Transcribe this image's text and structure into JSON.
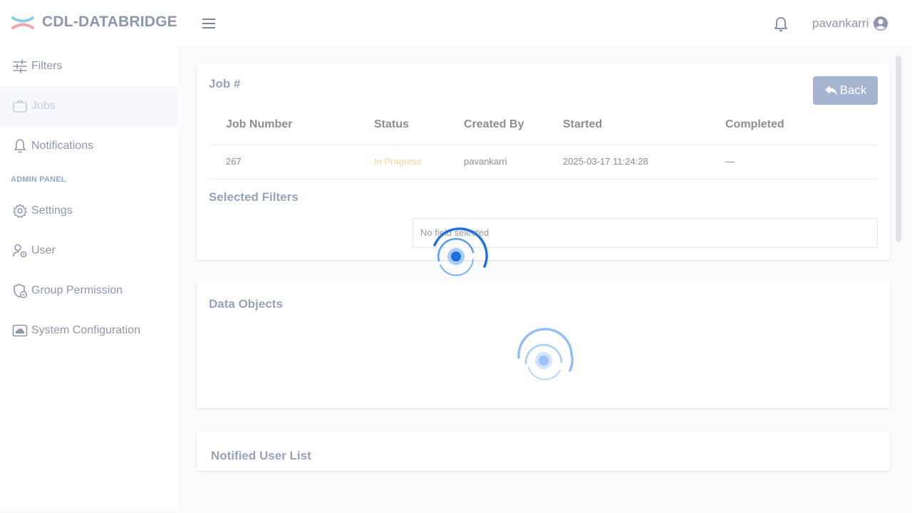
{
  "header": {
    "brand": "CDL-DATABRIDGE",
    "username": "pavankarri",
    "icons": [
      "logo-icon",
      "menu-icon",
      "bell-icon",
      "user-circle-icon"
    ]
  },
  "sidebar": {
    "items": [
      {
        "label": "Filters",
        "icon": "filters-icon"
      },
      {
        "label": "Jobs",
        "icon": "briefcase-icon"
      },
      {
        "label": "Notifications",
        "icon": "bell-icon"
      }
    ],
    "admin_heading": "ADMIN PANEL",
    "admin_items": [
      {
        "label": "Settings",
        "icon": "gear-icon"
      },
      {
        "label": "User",
        "icon": "user-gear-icon"
      },
      {
        "label": "Group Permission",
        "icon": "shield-icon"
      },
      {
        "label": "System Configuration",
        "icon": "cloud-icon"
      }
    ]
  },
  "job_card": {
    "title": "Job #",
    "back_label": "Back",
    "columns": [
      "Job Number",
      "Status",
      "Created By",
      "Started",
      "Completed"
    ],
    "row": {
      "job_number": "267",
      "status": "In Progress",
      "created_by": "pavankarri",
      "started": "2025-03-17 11:24:28",
      "completed": "—"
    },
    "selected_filters_title": "Selected Filters",
    "selected_filters_empty": "No field selected"
  },
  "data_objects": {
    "title": "Data Objects"
  },
  "notified_users": {
    "title": "Notified User List"
  },
  "colors": {
    "status_in_progress": "#f8d79a",
    "spinner_primary": "#1f6fe0",
    "back_button": "#a6b4d1"
  }
}
